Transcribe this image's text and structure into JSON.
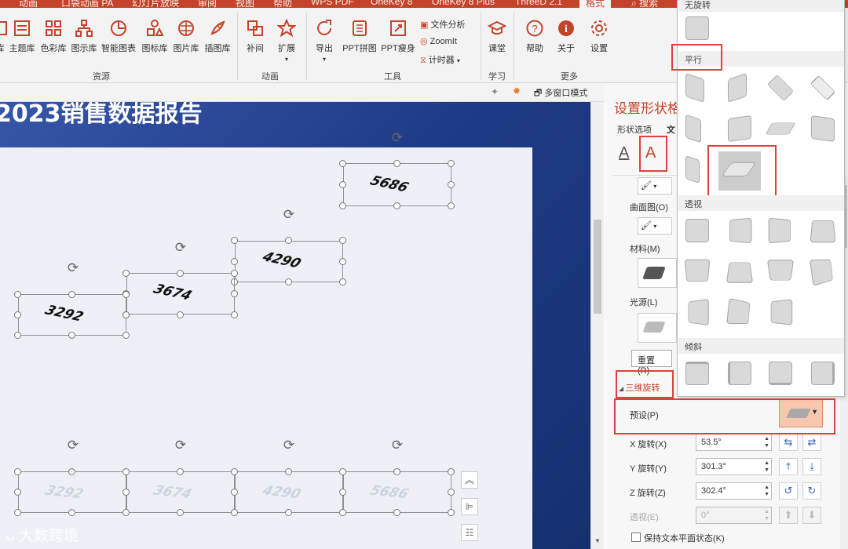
{
  "tabs": [
    "动画",
    "口袋动画 PA",
    "幻灯片放映",
    "审阅",
    "视图",
    "帮助",
    "WPS PDF",
    "OneKey 8",
    "OneKey 8 Plus",
    "ThreeD 2.1",
    "格式",
    "搜索"
  ],
  "ribbon": {
    "resources": [
      "主题库",
      "色彩库",
      "图示库",
      "智能图表",
      "图标库",
      "图片库",
      "插图库"
    ],
    "resources_group": "资源",
    "animation": [
      "补间",
      "扩展"
    ],
    "animation_group": "动画",
    "tools": [
      "导出",
      "PPT拼图",
      "PPT瘦身"
    ],
    "tools_small": [
      "文件分析",
      "ZoomIt",
      "计时器"
    ],
    "tools_group": "工具",
    "learn": [
      "课堂"
    ],
    "learn_group": "学习",
    "more": [
      "帮助",
      "关于",
      "设置"
    ],
    "more_group": "更多",
    "multiwindow": "多窗口模式"
  },
  "slide": {
    "title": "2023销售数据报告",
    "numbers": [
      "5686",
      "4290",
      "3674",
      "3292"
    ],
    "ghost_numbers": [
      "3292",
      "3674",
      "4290",
      "5686"
    ],
    "watermark": "大数跨境"
  },
  "pane": {
    "title": "设置形状格式",
    "tab_shape": "形状选项",
    "tab_text": "文",
    "curve_label": "曲面图(O)",
    "material_label": "材料(M)",
    "light_label": "光源(L)",
    "reset_button": "重置(R)",
    "section_3d": "三维旋转",
    "preset_label": "预设(P)",
    "x_label": "X 旋转(X)",
    "x_value": "53.5°",
    "y_label": "Y 旋转(Y)",
    "y_value": "301.3°",
    "z_label": "Z 旋转(Z)",
    "z_value": "302.4°",
    "perspective_label": "透视(E)",
    "perspective_value": "0°",
    "keep_text_flat": "保持文本平面状态(K)"
  },
  "gallery": {
    "no_rotation": "无旋转",
    "parallel": "平行",
    "perspective": "透视",
    "oblique": "倾斜"
  },
  "colors": {
    "accent": "#c4432a",
    "highlight": "#e0413a",
    "slide_bg": "#203f8e"
  }
}
